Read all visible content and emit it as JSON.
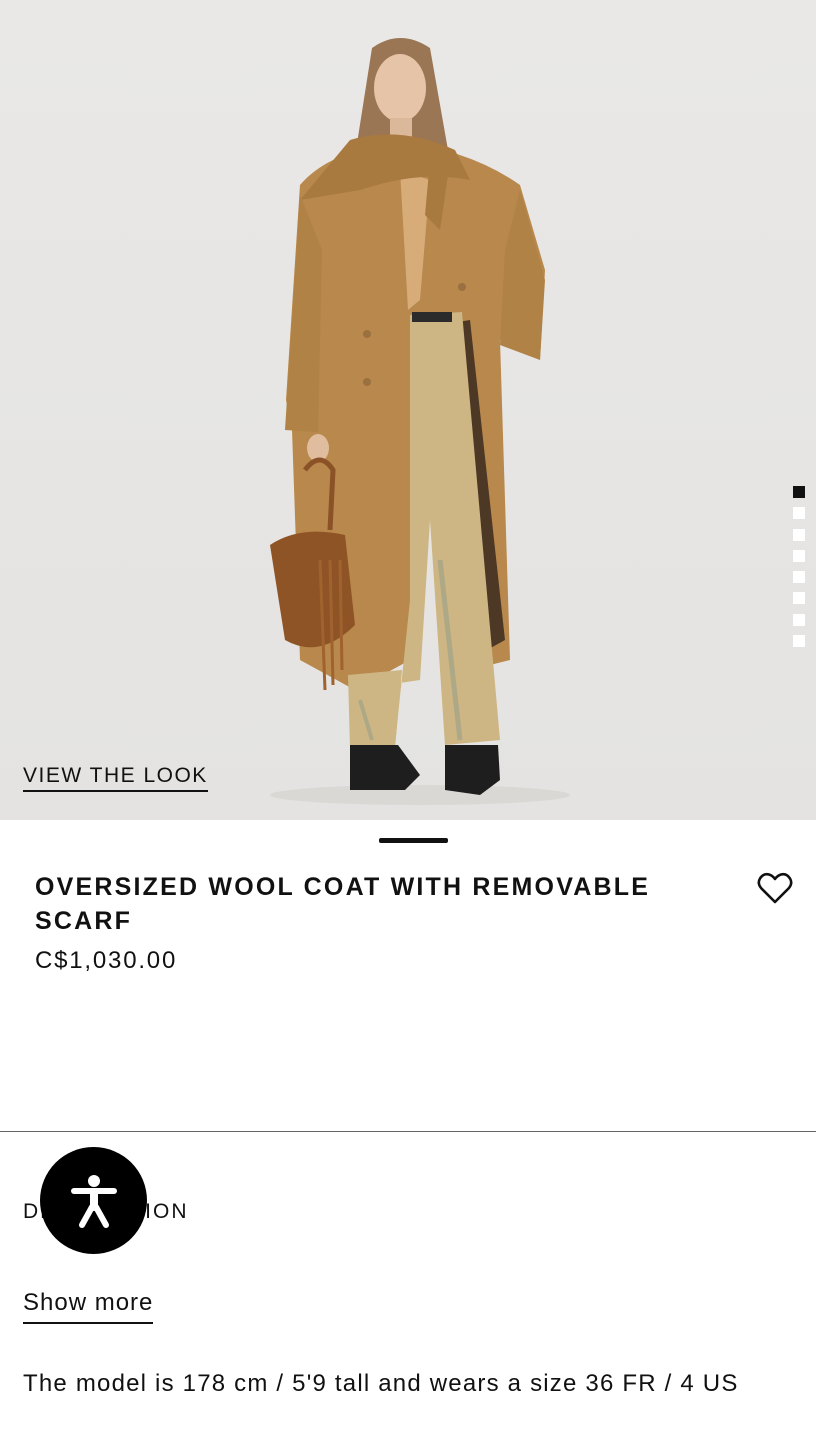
{
  "hero": {
    "view_look_label": "VIEW THE LOOK",
    "slide_count": 8,
    "active_slide": 1
  },
  "product": {
    "title": "OVERSIZED WOOL COAT WITH REMOVABLE SCARF",
    "price": "C$1,030.00",
    "wishlist_icon": "heart-icon"
  },
  "description": {
    "label": "DESCRIPTION",
    "show_more_label": "Show more",
    "model_info": "The model is 178 cm / 5'9 tall and wears a size 36 FR / 4 US"
  },
  "accessibility": {
    "icon": "accessibility-icon"
  },
  "colors": {
    "text": "#111111",
    "background": "#ffffff",
    "coat": "#b8884c",
    "jeans": "#cdb683"
  }
}
